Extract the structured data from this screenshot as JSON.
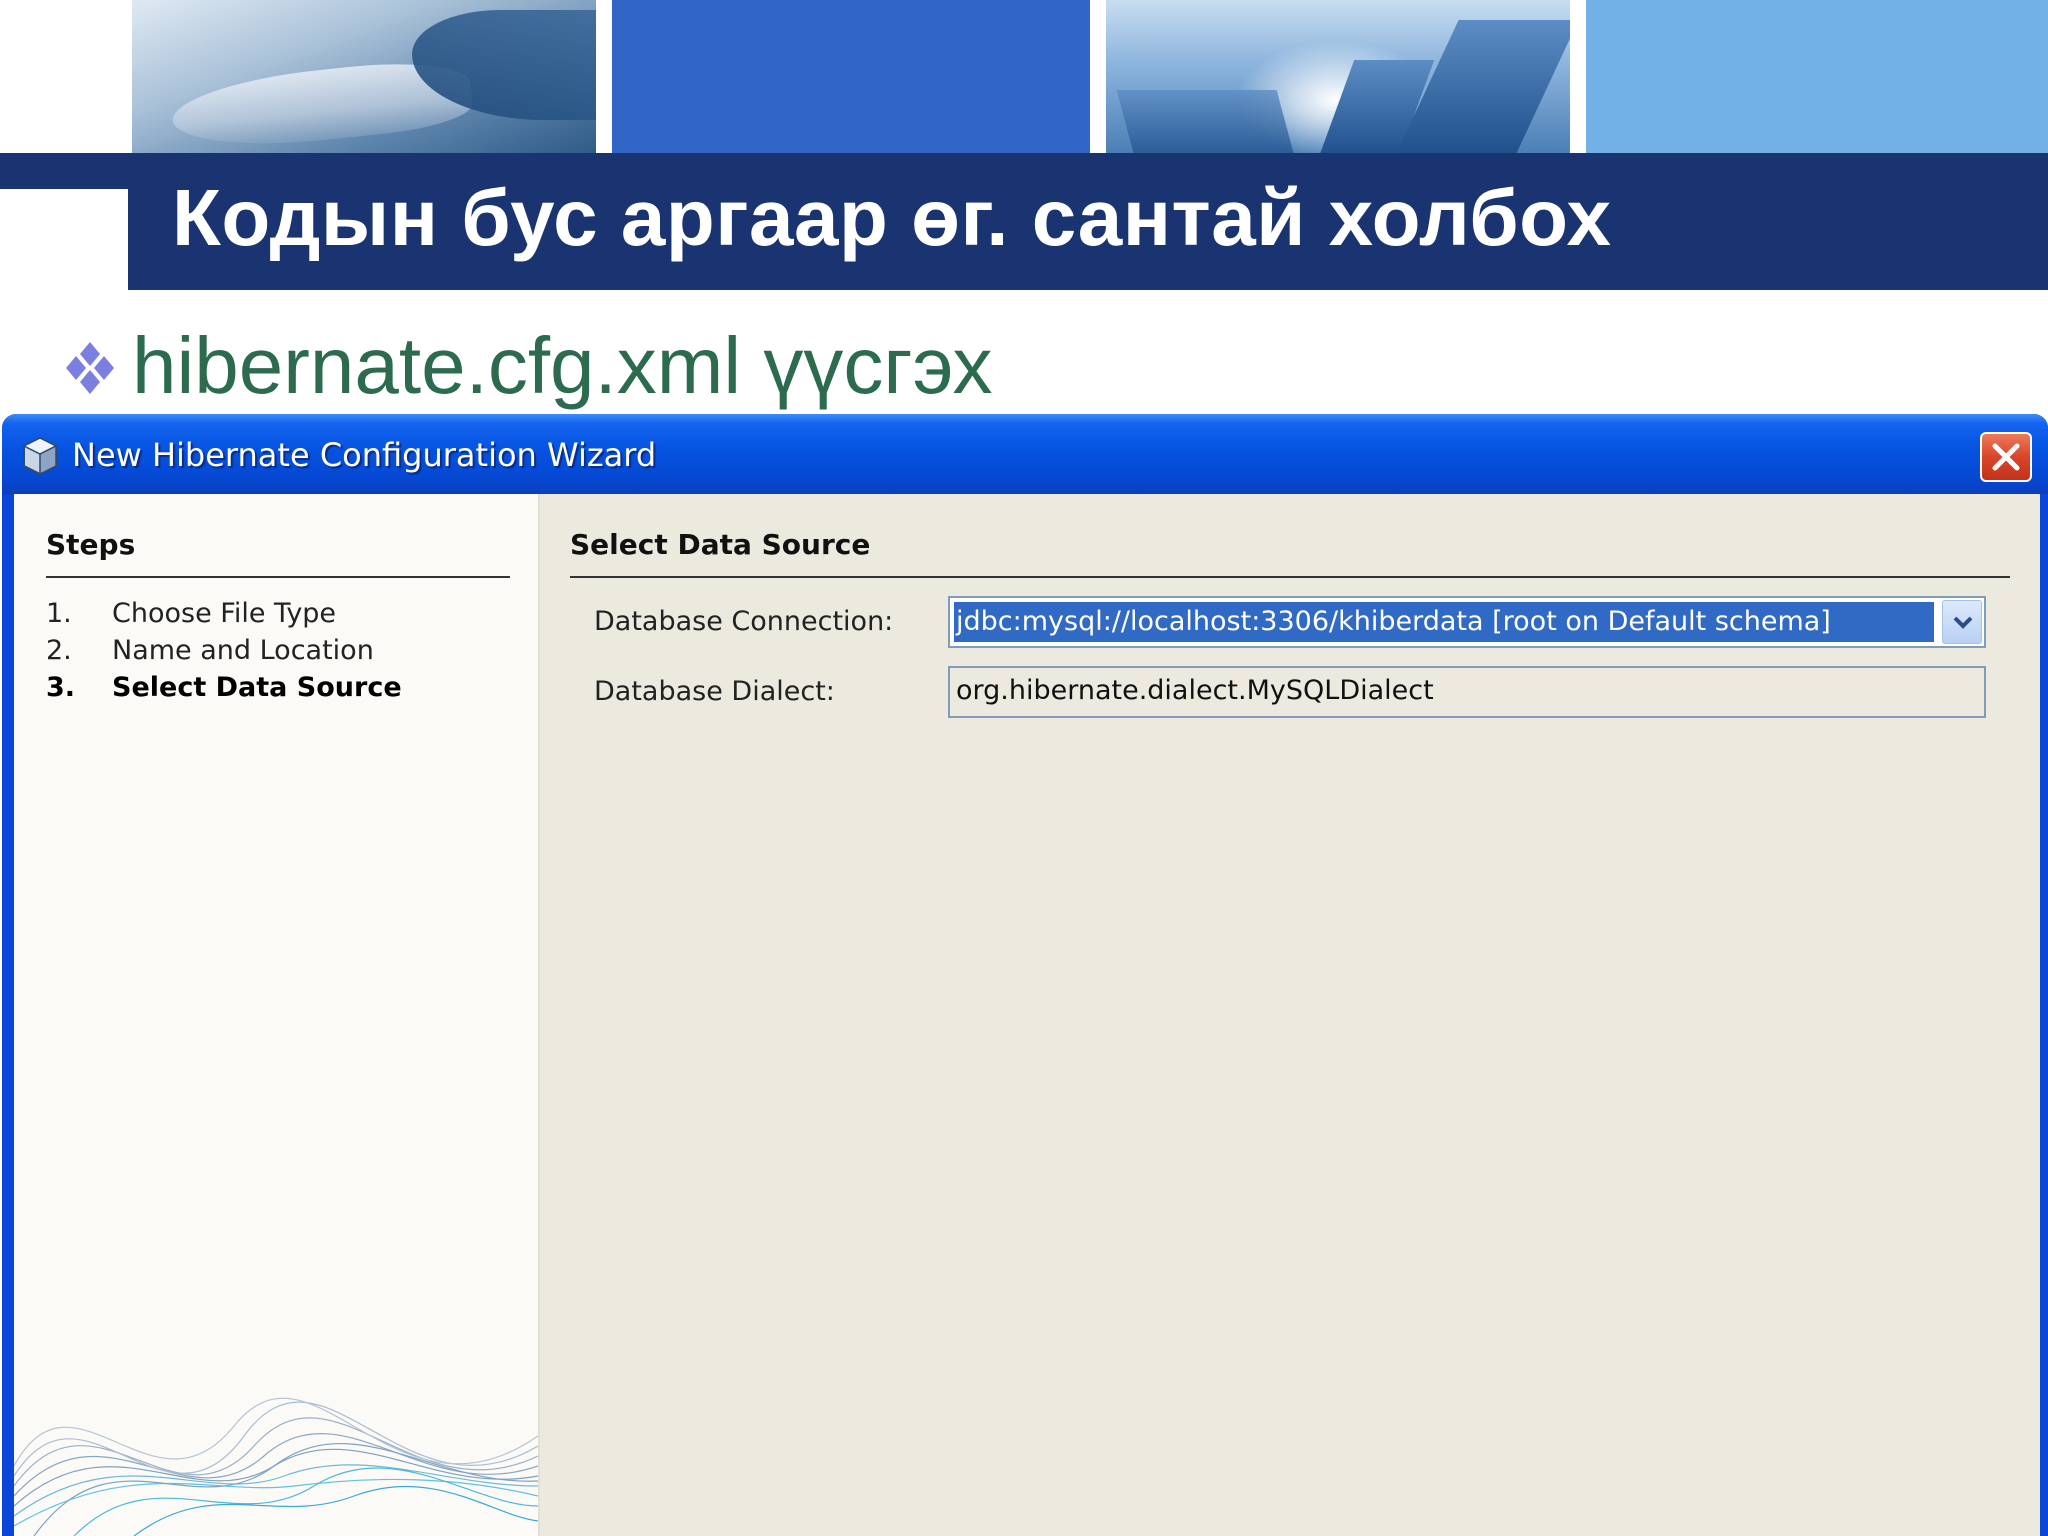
{
  "slide": {
    "title": "Кодын бус аргаар өг. сантай холбох",
    "bullet": "hibernate.cfg.xml үүсгэх"
  },
  "dialog": {
    "title": "New Hibernate Configuration Wizard",
    "steps": {
      "heading": "Steps",
      "items": [
        {
          "num": "1.",
          "label": "Choose File Type",
          "current": false
        },
        {
          "num": "2.",
          "label": "Name and Location",
          "current": false
        },
        {
          "num": "3.",
          "label": "Select Data Source",
          "current": true
        }
      ]
    },
    "content": {
      "heading": "Select Data Source",
      "connection_label": "Database Connection:",
      "connection_value": "jdbc:mysql://localhost:3306/khiberdata [root on Default schema]",
      "dialect_label": "Database Dialect:",
      "dialect_value": "org.hibernate.dialect.MySQLDialect"
    }
  },
  "colors": {
    "title_band": "#1a3472",
    "bullet_text": "#2d6b4f",
    "bullet_icon": "#7b7fe0",
    "selection": "#316ac5",
    "xp_titlebar": "#0553e0",
    "dialog_bg": "#ece9df"
  },
  "icons": {
    "bullet": "diamond-bullet-icon",
    "dialog": "cube-icon",
    "close": "close-icon",
    "dropdown": "chevron-down-icon"
  }
}
